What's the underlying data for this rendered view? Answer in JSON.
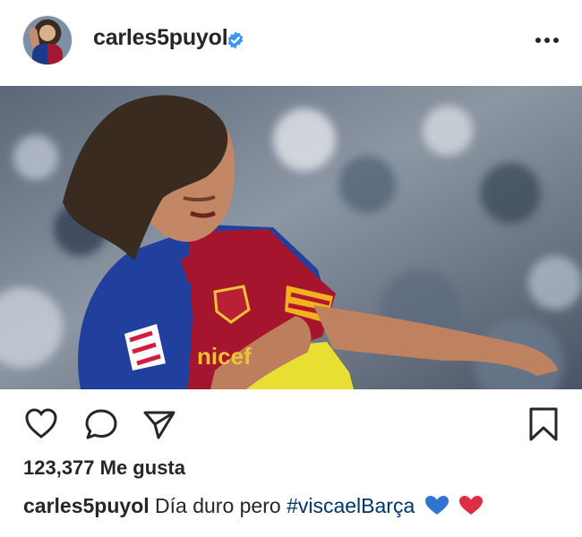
{
  "post": {
    "username": "carles5puyol",
    "likes_text": "123,377 Me gusta",
    "caption_user": "carles5puyol",
    "caption_text": "Día duro pero",
    "caption_hashtag": "#viscaelBarça",
    "emojis": [
      "blue-heart",
      "red-heart"
    ]
  },
  "colors": {
    "text": "#262626",
    "hashtag": "#003569",
    "verified": "#3897f0",
    "blue_heart": "#2f74d0",
    "red_heart": "#dd2e44"
  }
}
